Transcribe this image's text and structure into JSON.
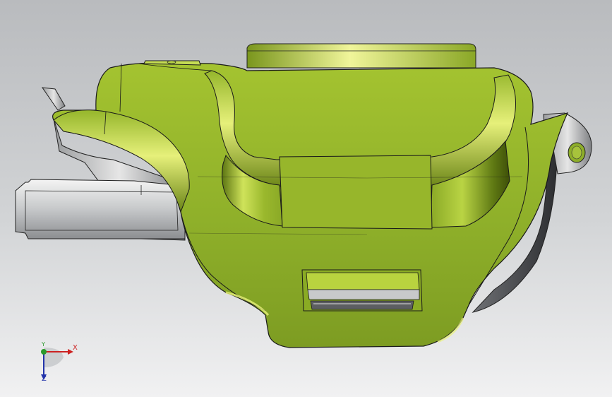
{
  "viewport": {
    "background": "#d2d4d6"
  },
  "model": {
    "body_color": "#8fb02a",
    "highlight_color": "#e8f27a",
    "shadow_color": "#3e4f08",
    "metal_color": "#cfd1d3",
    "edge_color": "#1a1a1a"
  },
  "triad": {
    "x_label": "X",
    "y_label": "Y",
    "z_label": "Z",
    "x_color": "#cc2222",
    "y_color": "#2a9a2a",
    "z_color": "#2233aa"
  }
}
